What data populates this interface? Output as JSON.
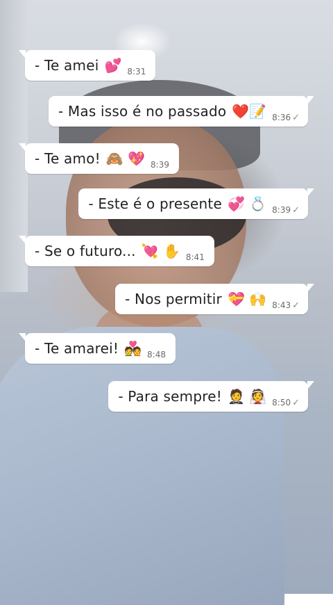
{
  "messages": [
    {
      "direction": "in",
      "text": "- Te amei",
      "emoji": "💕",
      "time": "8:31",
      "tick": ""
    },
    {
      "direction": "out",
      "text": "- Mas isso é no passado",
      "emoji": "❤️📝",
      "time": "8:36",
      "tick": "✓"
    },
    {
      "direction": "in",
      "text": "-  Te amo!",
      "emoji": "🙈 💖",
      "time": "8:39",
      "tick": ""
    },
    {
      "direction": "out",
      "text": "- Este é o presente",
      "emoji": "💞 💍",
      "time": "8:39",
      "tick": "✓"
    },
    {
      "direction": "in",
      "text": "- Se o futuro...",
      "emoji": "💘 ✋",
      "time": "8:41",
      "tick": ""
    },
    {
      "direction": "out",
      "text": "-  Nos permitir",
      "emoji": "💝 🙌",
      "time": "8:43",
      "tick": "✓"
    },
    {
      "direction": "in",
      "text": "- Te amarei!",
      "emoji": "💑",
      "time": "8:48",
      "tick": ""
    },
    {
      "direction": "out",
      "text": "- Para sempre!",
      "emoji": "🤵 👰",
      "time": "8:50",
      "tick": "✓"
    }
  ]
}
